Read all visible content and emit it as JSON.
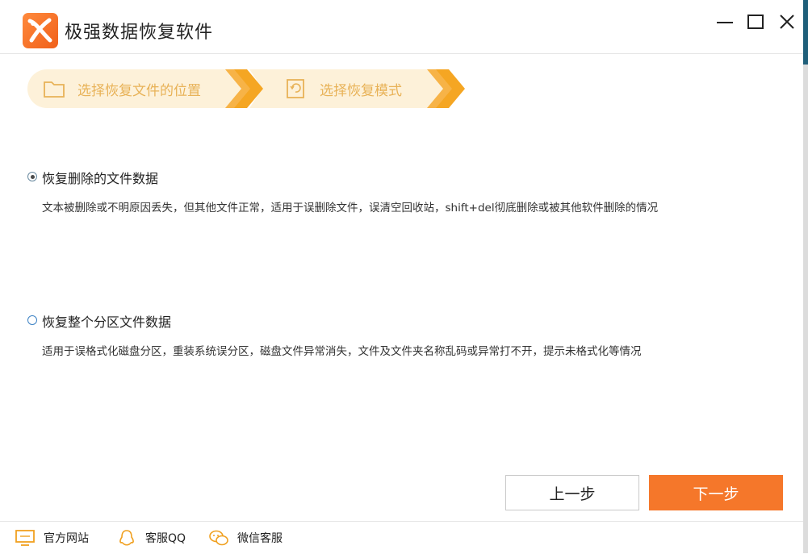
{
  "window": {
    "title": "极强数据恢复软件",
    "controls": [
      "minimize-icon",
      "maximize-icon",
      "close-icon"
    ]
  },
  "steps": [
    {
      "label": "选择恢复文件的位置",
      "icon": "folder-icon"
    },
    {
      "label": "选择恢复模式",
      "icon": "restore-icon"
    }
  ],
  "options": [
    {
      "label": "恢复删除的文件数据",
      "description": "文本被删除或不明原因丢失，但其他文件正常，适用于误删除文件，误清空回收站，shift+del彻底删除或被其他软件删除的情况",
      "selected": true
    },
    {
      "label": "恢复整个分区文件数据",
      "description": "适用于误格式化磁盘分区，重装系统误分区，磁盘文件异常消失，文件及文件夹名称乱码或异常打不开，提示未格式化等情况",
      "selected": false
    }
  ],
  "buttons": {
    "prev": "上一步",
    "next": "下一步"
  },
  "footer": [
    {
      "label": "官方网站",
      "icon": "monitor-icon"
    },
    {
      "label": "客服QQ",
      "icon": "qq-icon"
    },
    {
      "label": "微信客服",
      "icon": "wechat-icon"
    }
  ],
  "colors": {
    "accent": "#f5772a",
    "step_text": "#e8b257",
    "step_bg": "#fdf1d9",
    "step_arrow": "#f5a623"
  }
}
